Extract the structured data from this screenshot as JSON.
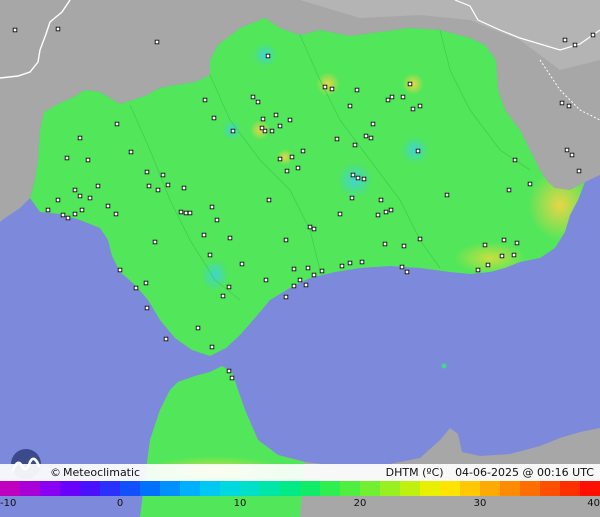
{
  "brand": {
    "name": "Meteoclimatic",
    "logo_icon": "meteoclimatic-logo-icon"
  },
  "map": {
    "variable": "DHTM (ºC)",
    "datetime": "04-06-2025 @ 00:16 UTC",
    "colors": {
      "sea": "#7d89db",
      "land_outside": "#a9a9a9",
      "region_base": "#52e65a",
      "warm_spot": "#e2d94a",
      "cool_spot": "#40d6c4",
      "station_marker": "#ffffff"
    }
  },
  "color_scale": {
    "min": -10,
    "max": 40,
    "tick_labels": [
      "-10",
      "0",
      "10",
      "20",
      "30",
      "40"
    ],
    "colors": [
      "#c000c0",
      "#a800d8",
      "#8a00f0",
      "#6a00ff",
      "#4a10ff",
      "#2a30ff",
      "#1050ff",
      "#0070ff",
      "#0090ff",
      "#00b0ff",
      "#00c8f0",
      "#00d8e0",
      "#00e0c8",
      "#00e6a8",
      "#00ea88",
      "#10ec68",
      "#30ee50",
      "#50ee40",
      "#70f030",
      "#98f020",
      "#c0f010",
      "#e8f000",
      "#ffe400",
      "#ffc800",
      "#ffaa00",
      "#ff8c00",
      "#ff6e00",
      "#ff5000",
      "#ff3000",
      "#ff1000"
    ]
  }
}
